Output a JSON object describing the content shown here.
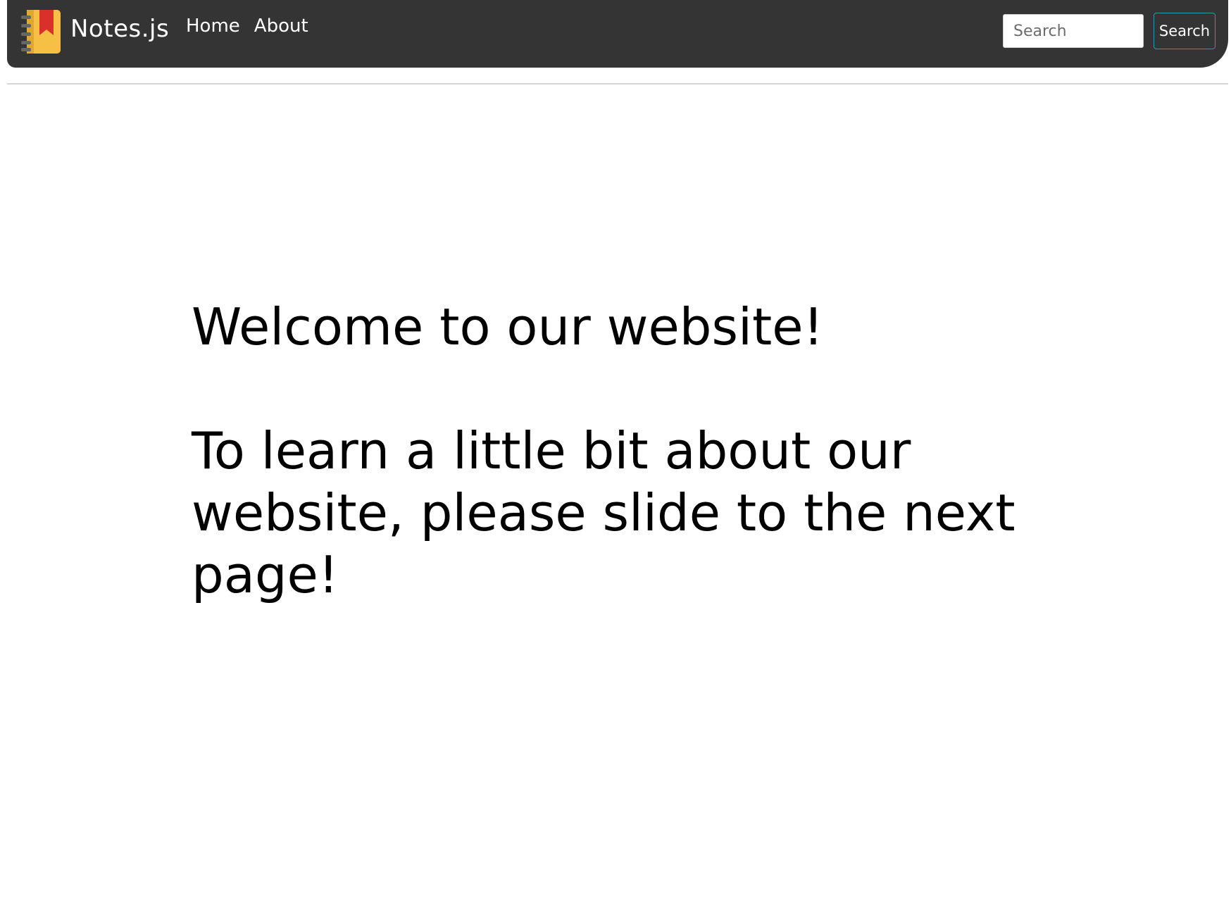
{
  "navbar": {
    "brand": {
      "logo_icon": "notebook-icon",
      "name": "Notes.js"
    },
    "links": [
      {
        "label": "Home"
      },
      {
        "label": "About"
      }
    ],
    "search": {
      "placeholder": "Search",
      "value": "",
      "button_label": "Search"
    }
  },
  "main": {
    "headline": "Welcome to our website!",
    "message": "To learn a little bit about our website, please slide to the next page!"
  },
  "colors": {
    "navbar_background": "#343434",
    "search_button_border": "#2a9aa8",
    "logo_cover": "#f5c043",
    "logo_bookmark": "#d9302b"
  }
}
